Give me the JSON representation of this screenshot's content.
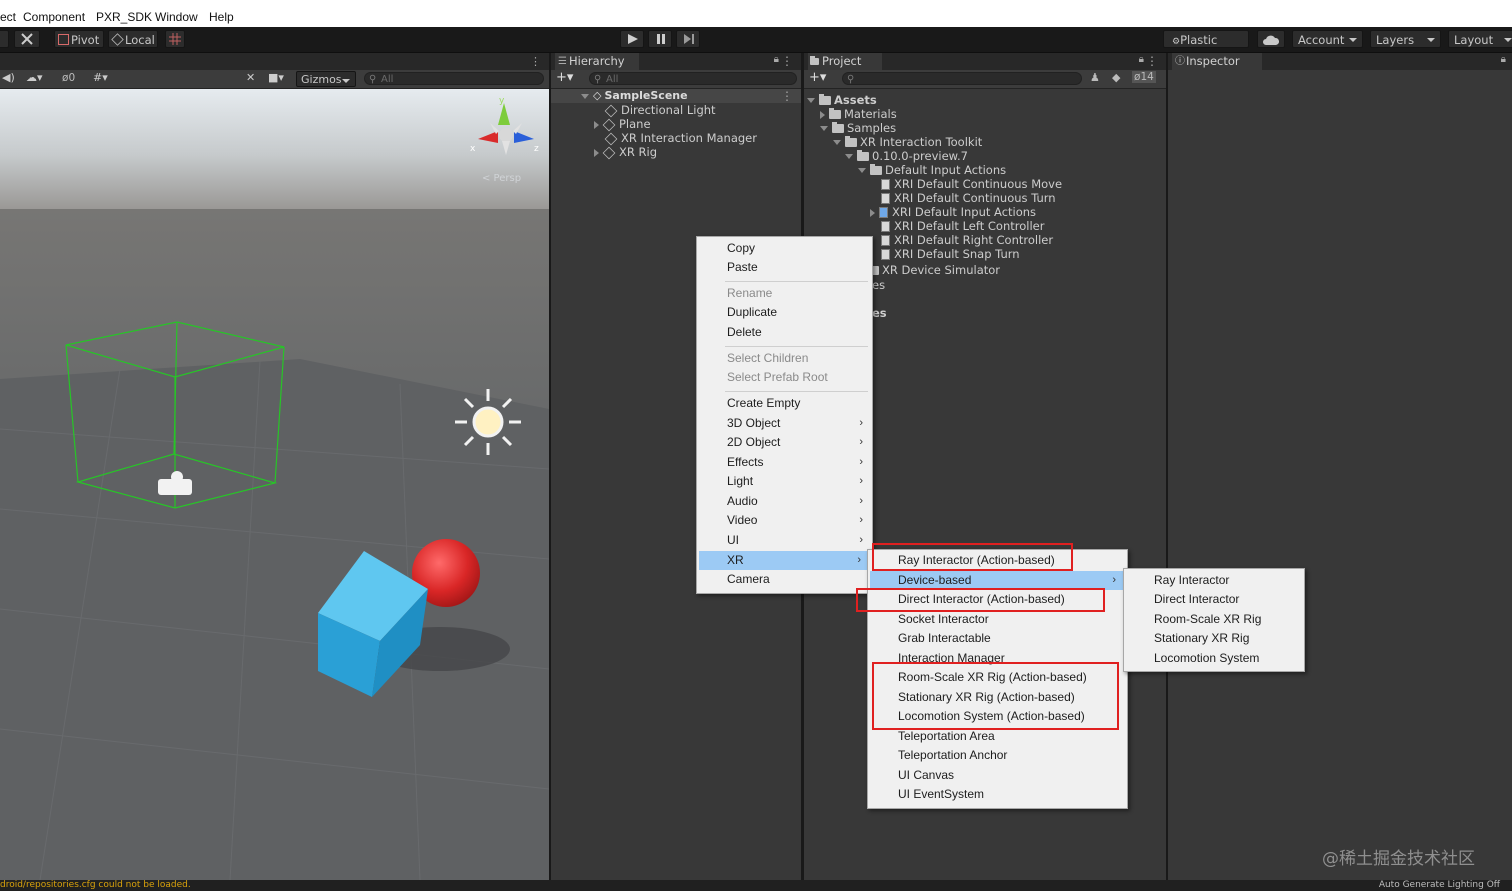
{
  "menubar": {
    "items": [
      "ect",
      "Component",
      "PXR_SDK",
      "Window",
      "Help"
    ]
  },
  "toolbar": {
    "pivot": "Pivot",
    "local": "Local",
    "plastic_scm": "Plastic SCM",
    "account": "Account",
    "layers": "Layers",
    "layout": "Layout"
  },
  "scene": {
    "hidden_count": "0",
    "gizmos": "Gizmos",
    "search_placeholder": "All",
    "persp": "< Persp",
    "axes": {
      "x": "x",
      "y": "y",
      "z": "z"
    }
  },
  "hierarchy": {
    "tab": "Hierarchy",
    "search_placeholder": "All",
    "scene_name": "SampleScene",
    "items": [
      "Directional Light",
      "Plane",
      "XR Interaction Manager",
      "XR Rig"
    ]
  },
  "project": {
    "tab": "Project",
    "hidden_count": "14",
    "tree": [
      {
        "label": "Assets",
        "depth": 0
      },
      {
        "label": "Materials",
        "depth": 1
      },
      {
        "label": "Samples",
        "depth": 1
      },
      {
        "label": "XR Interaction Toolkit",
        "depth": 2
      },
      {
        "label": "0.10.0-preview.7",
        "depth": 3
      },
      {
        "label": "Default Input Actions",
        "depth": 4
      },
      {
        "label": "XRI Default Continuous Move",
        "depth": 5
      },
      {
        "label": "XRI Default Continuous Turn",
        "depth": 5
      },
      {
        "label": "XRI Default Input Actions",
        "depth": 5
      },
      {
        "label": "XRI Default Left Controller",
        "depth": 5
      },
      {
        "label": "XRI Default Right Controller",
        "depth": 5
      },
      {
        "label": "XRI Default Snap Turn",
        "depth": 5
      },
      {
        "label": "XR Device Simulator",
        "depth": 4
      }
    ],
    "partial": [
      "es",
      "es"
    ]
  },
  "inspector": {
    "tab": "Inspector"
  },
  "context_menu": {
    "items": [
      {
        "label": "Copy"
      },
      {
        "label": "Paste"
      },
      {
        "label": "Rename"
      },
      {
        "label": "Duplicate"
      },
      {
        "label": "Delete"
      },
      {
        "label": "Select Children"
      },
      {
        "label": "Select Prefab Root"
      },
      {
        "label": "Create Empty"
      },
      {
        "label": "3D Object"
      },
      {
        "label": "2D Object"
      },
      {
        "label": "Effects"
      },
      {
        "label": "Light"
      },
      {
        "label": "Audio"
      },
      {
        "label": "Video"
      },
      {
        "label": "UI"
      },
      {
        "label": "XR"
      },
      {
        "label": "Camera"
      }
    ]
  },
  "xr_menu": {
    "items": [
      "Ray Interactor (Action-based)",
      "Device-based",
      "Direct Interactor (Action-based)",
      "Socket Interactor",
      "Grab Interactable",
      "Interaction Manager",
      "Room-Scale XR Rig (Action-based)",
      "Stationary XR Rig (Action-based)",
      "Locomotion System (Action-based)",
      "Teleportation Area",
      "Teleportation Anchor",
      "UI Canvas",
      "UI EventSystem"
    ]
  },
  "device_menu": {
    "items": [
      "Ray Interactor",
      "Direct Interactor",
      "Room-Scale XR Rig",
      "Stationary XR Rig",
      "Locomotion System"
    ]
  },
  "status": {
    "left": "droid/repositories.cfg could not be loaded.",
    "right": "Auto Generate Lighting Off"
  },
  "watermark": "@稀土掘金技术社区",
  "colors": {
    "highlight": "#9ccaf4",
    "annotation": "#e02020",
    "bounds": "#27c527"
  }
}
